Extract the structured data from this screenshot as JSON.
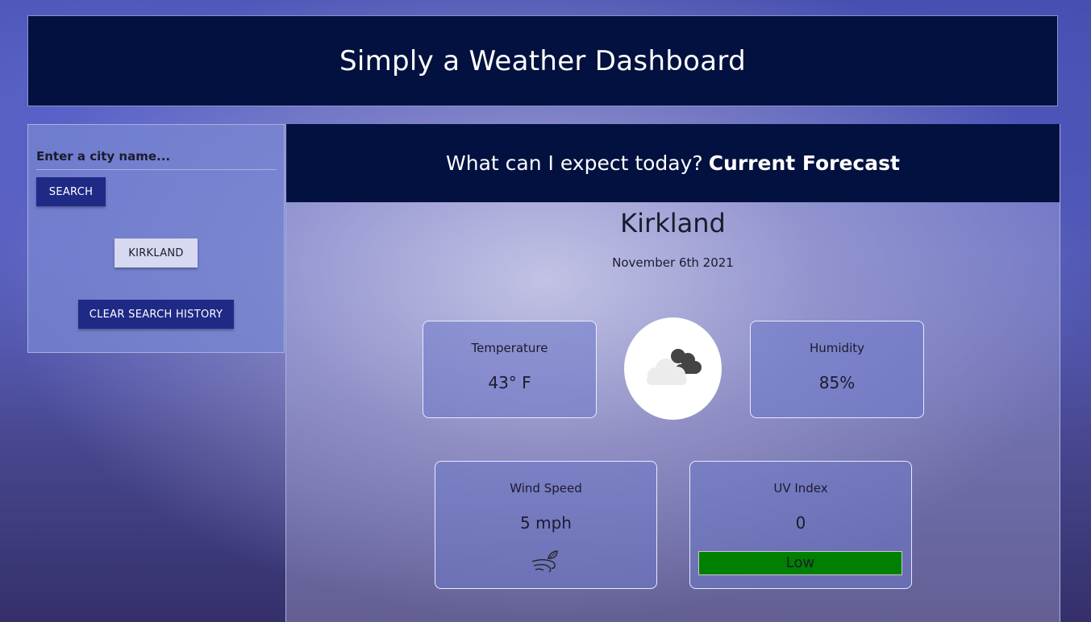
{
  "header": {
    "title": "Simply a Weather Dashboard"
  },
  "sidebar": {
    "input_placeholder": "Enter a city name...",
    "search_label": "SEARCH",
    "history": [
      "KIRKLAND"
    ],
    "clear_label": "CLEAR SEARCH HISTORY"
  },
  "main": {
    "title_prefix": "What can I expect today?",
    "title_bold": "Current Forecast",
    "city": "Kirkland",
    "date": "November 6th 2021",
    "weather_icon": "cloudy-icon",
    "temperature": {
      "label": "Temperature",
      "value": "43° F"
    },
    "humidity": {
      "label": "Humidity",
      "value": "85%"
    },
    "wind": {
      "label": "Wind Speed",
      "value": "5 mph",
      "icon": "wind-icon"
    },
    "uv": {
      "label": "UV Index",
      "value": "0",
      "level": "Low",
      "level_color": "#008000"
    }
  },
  "colors": {
    "header_bg": "#02113f",
    "button_bg": "#1f2a86"
  }
}
